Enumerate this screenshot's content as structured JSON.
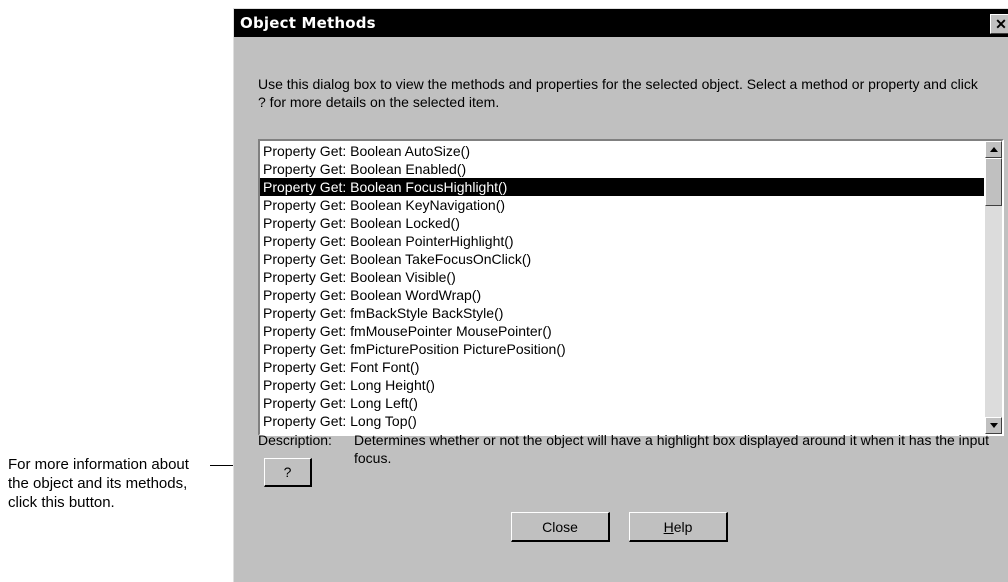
{
  "callout": {
    "text": "For more information about the object and its methods, click this button."
  },
  "dialog": {
    "title": "Object Methods",
    "close_glyph": "✕",
    "instructions": "Use this dialog box to view the methods and properties for the selected object.  Select a method or property and click ?  for more details on the selected item.",
    "list": {
      "items": [
        "Property Get: Boolean AutoSize()",
        "Property Get: Boolean Enabled()",
        "Property Get: Boolean FocusHighlight()",
        "Property Get: Boolean KeyNavigation()",
        "Property Get: Boolean Locked()",
        "Property Get: Boolean PointerHighlight()",
        "Property Get: Boolean TakeFocusOnClick()",
        "Property Get: Boolean Visible()",
        "Property Get: Boolean WordWrap()",
        "Property Get: fmBackStyle BackStyle()",
        "Property Get: fmMousePointer MousePointer()",
        "Property Get: fmPicturePosition PicturePosition()",
        "Property Get: Font Font()",
        "Property Get: Long Height()",
        "Property Get: Long Left()",
        "Property Get: Long Top()"
      ],
      "selected_index": 2
    },
    "description_label": "Description:",
    "description_text": "Determines whether or not the object will have a highlight box displayed around it when it has the input focus.",
    "question_button": "?",
    "close_button": "Close",
    "help_button": "Help"
  },
  "colors": {
    "dialog_bg": "#c0c0c0",
    "titlebar": "#000000",
    "selection": "#000000"
  }
}
